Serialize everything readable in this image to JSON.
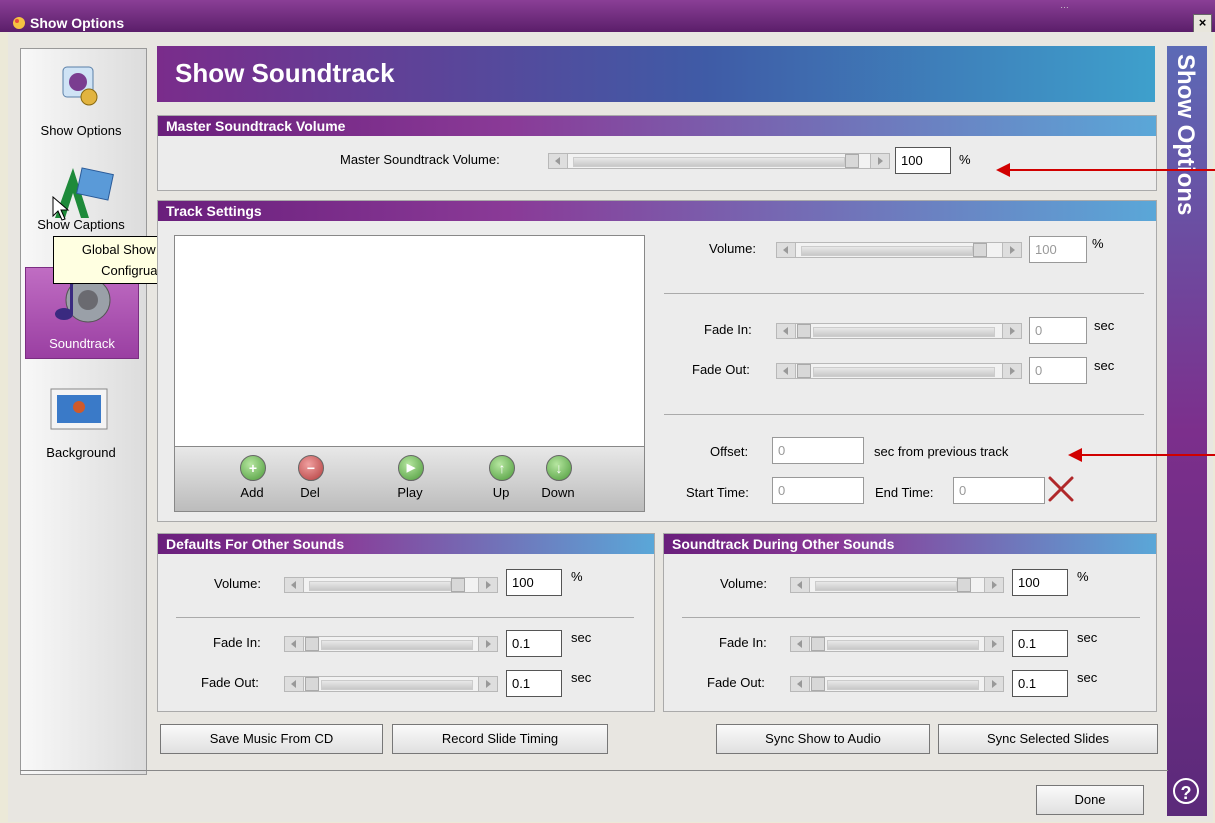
{
  "window": {
    "title": "Show Options",
    "close_label": "×"
  },
  "nav": {
    "items": [
      {
        "label": "Show Options",
        "icon": "show-options-icon"
      },
      {
        "label": "Show Captions",
        "icon": "captions-icon"
      },
      {
        "label": "Soundtrack",
        "icon": "soundtrack-icon"
      },
      {
        "label": "Background",
        "icon": "background-icon"
      }
    ],
    "active": "Soundtrack"
  },
  "tooltip": {
    "text": "Global Show Caption Configruations"
  },
  "header": {
    "title": "Show Soundtrack"
  },
  "sidebar": {
    "title": "Show Options",
    "help_label": "?"
  },
  "master": {
    "section_title": "Master Soundtrack Volume",
    "label": "Master Soundtrack Volume:",
    "value": "100",
    "unit": "%",
    "level": 1.0
  },
  "track": {
    "section_title": "Track Settings",
    "volume_label": "Volume:",
    "volume_value": "100",
    "volume_unit": "%",
    "volume_level": 1.0,
    "fade_in_label": "Fade In:",
    "fade_in_value": "0",
    "fade_in_unit": "sec",
    "fade_out_label": "Fade Out:",
    "fade_out_value": "0",
    "fade_out_unit": "sec",
    "offset_label": "Offset:",
    "offset_value": "0",
    "offset_suffix": "sec from previous track",
    "start_label": "Start Time:",
    "start_value": "0",
    "end_label": "End Time:",
    "end_value": "0",
    "buttons": [
      {
        "label": "Add",
        "glyph": "+",
        "color": "green"
      },
      {
        "label": "Del",
        "glyph": "−",
        "color": "red"
      },
      {
        "label": "Play",
        "glyph": "▶",
        "color": "green"
      },
      {
        "label": "Up",
        "glyph": "↑",
        "color": "green"
      },
      {
        "label": "Down",
        "glyph": "↓",
        "color": "green"
      }
    ]
  },
  "defaults": {
    "section_title": "Defaults For Other Sounds",
    "volume_label": "Volume:",
    "volume_value": "100",
    "volume_unit": "%",
    "fade_in_label": "Fade In:",
    "fade_in_value": "0.1",
    "fade_in_unit": "sec",
    "fade_out_label": "Fade Out:",
    "fade_out_value": "0.1",
    "fade_out_unit": "sec"
  },
  "during": {
    "section_title": "Soundtrack During Other Sounds",
    "volume_label": "Volume:",
    "volume_value": "100",
    "volume_unit": "%",
    "fade_in_label": "Fade In:",
    "fade_in_value": "0.1",
    "fade_in_unit": "sec",
    "fade_out_label": "Fade Out:",
    "fade_out_value": "0.1",
    "fade_out_unit": "sec"
  },
  "actions": {
    "save_music": "Save Music From CD",
    "record_timing": "Record Slide Timing",
    "sync_show": "Sync Show to Audio",
    "sync_selected": "Sync Selected Slides",
    "done": "Done"
  }
}
